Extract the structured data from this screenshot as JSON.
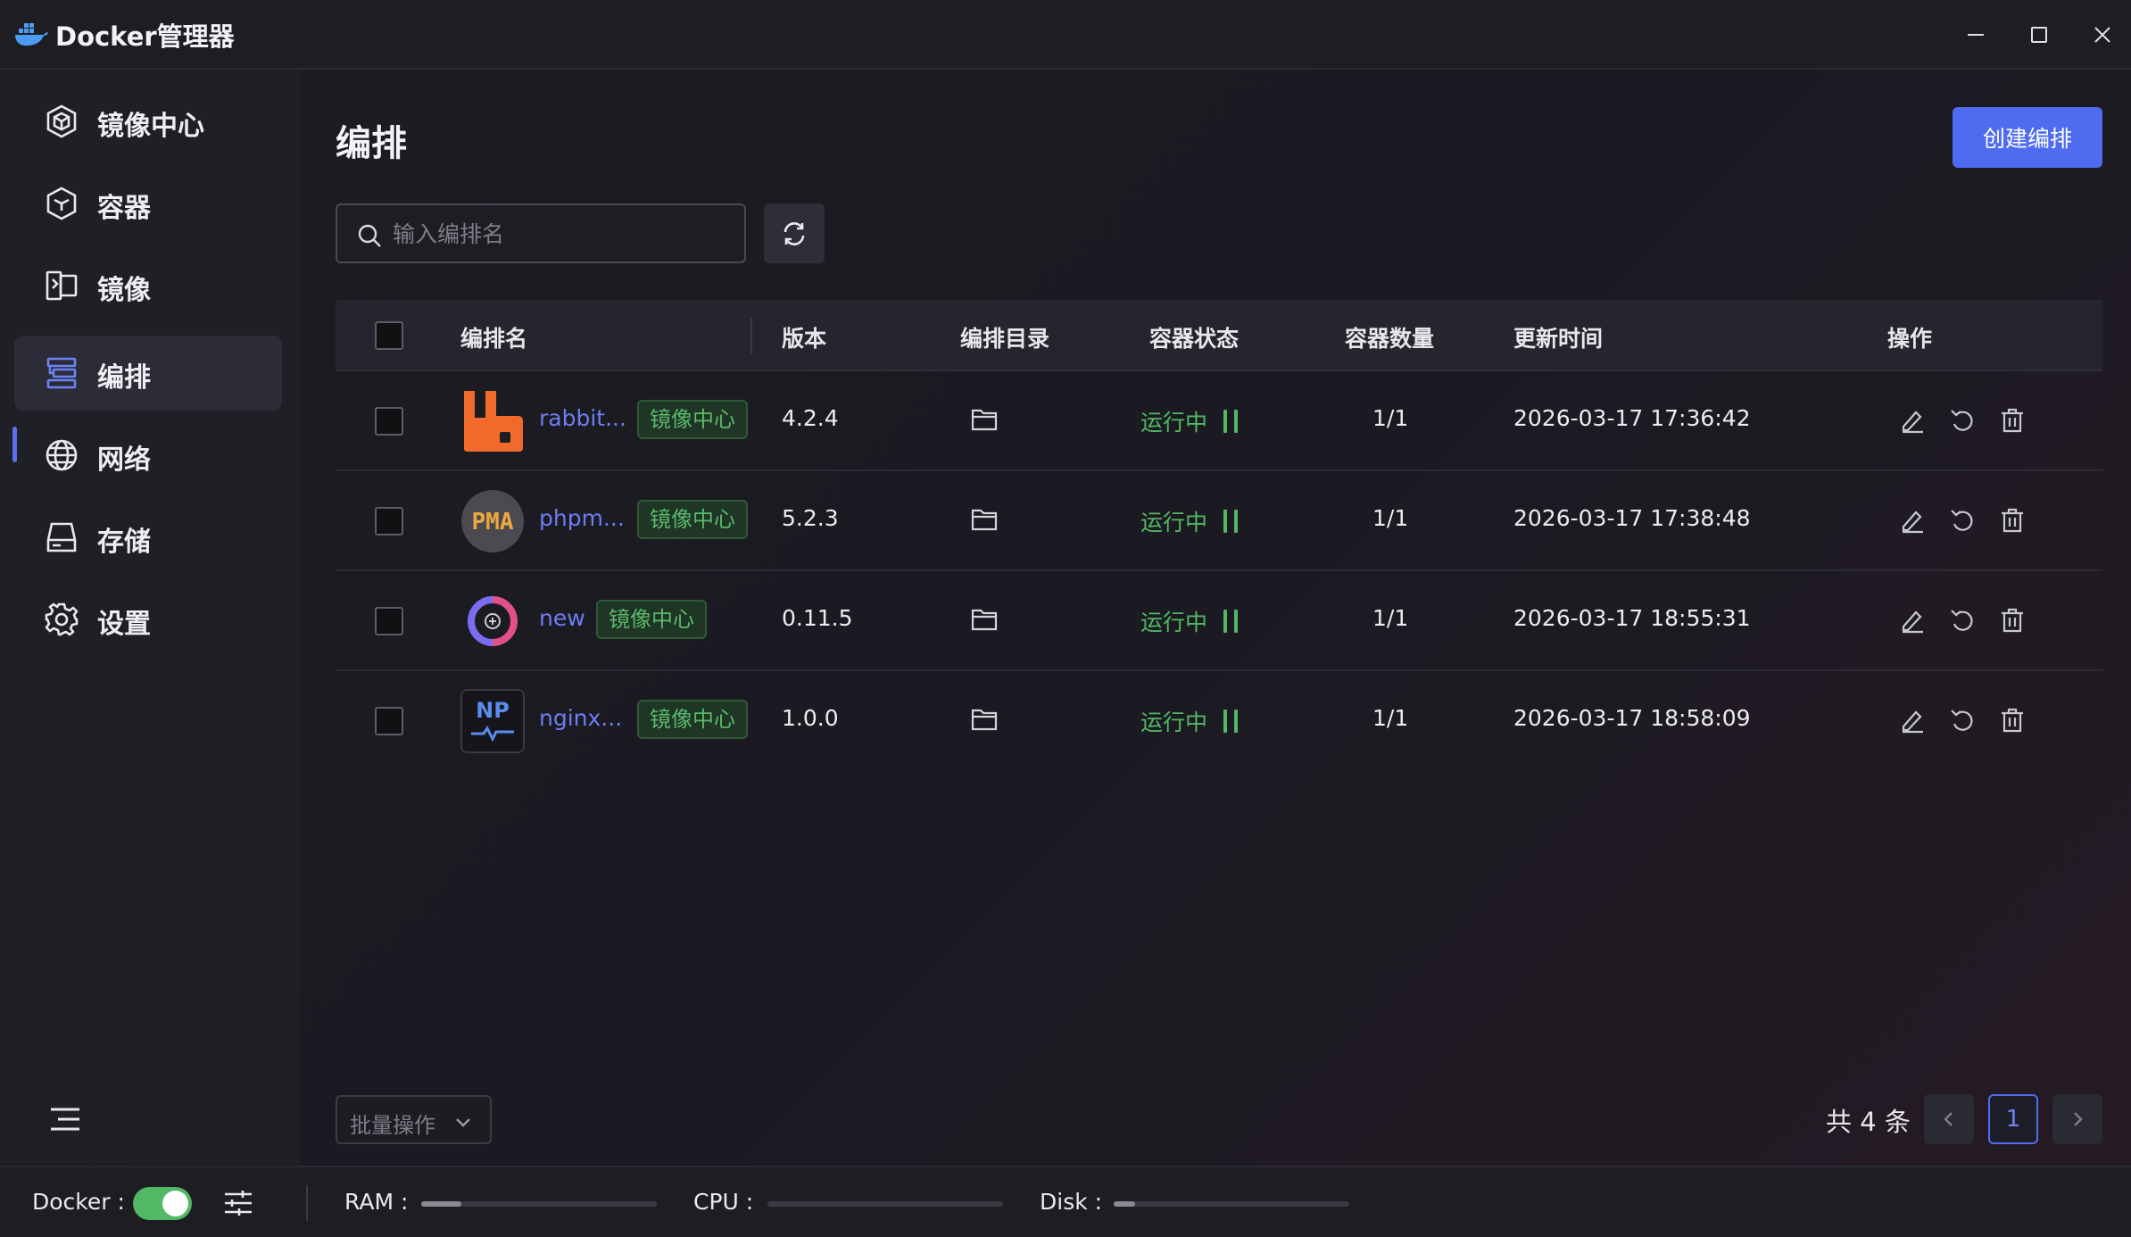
{
  "app": {
    "title": "Docker管理器"
  },
  "sidebar": {
    "items": [
      {
        "label": "镜像中心",
        "icon": "hub-icon"
      },
      {
        "label": "容器",
        "icon": "container-icon"
      },
      {
        "label": "镜像",
        "icon": "image-icon"
      },
      {
        "label": "编排",
        "icon": "compose-icon",
        "active": true
      },
      {
        "label": "网络",
        "icon": "network-icon"
      },
      {
        "label": "存储",
        "icon": "storage-icon"
      },
      {
        "label": "设置",
        "icon": "settings-icon"
      }
    ]
  },
  "page": {
    "title": "编排",
    "create_label": "创建编排"
  },
  "search": {
    "placeholder": "输入编排名"
  },
  "table": {
    "columns": [
      "编排名",
      "版本",
      "编排目录",
      "容器状态",
      "容器数量",
      "更新时间",
      "操作"
    ],
    "rows": [
      {
        "name": "rabbit...",
        "tag": "镜像中心",
        "version": "4.2.4",
        "status": "运行中",
        "count": "1/1",
        "updated": "2026-03-17 17:36:42",
        "icon": "rabbitmq-icon"
      },
      {
        "name": "phpm...",
        "tag": "镜像中心",
        "version": "5.2.3",
        "status": "运行中",
        "count": "1/1",
        "updated": "2026-03-17 17:38:48",
        "icon": "phpmyadmin-icon",
        "icon_text": "PMA"
      },
      {
        "name": "new",
        "tag": "镜像中心",
        "version": "0.11.5",
        "status": "运行中",
        "count": "1/1",
        "updated": "2026-03-17 18:55:31",
        "icon": "new-app-icon"
      },
      {
        "name": "nginx...",
        "tag": "镜像中心",
        "version": "1.0.0",
        "status": "运行中",
        "count": "1/1",
        "updated": "2026-03-17 18:58:09",
        "icon": "nginx-proxy-icon",
        "icon_text": "NP"
      }
    ]
  },
  "footer": {
    "batch_label": "批量操作",
    "total": "共 4 条",
    "current_page": "1"
  },
  "statusbar": {
    "docker_label": "Docker :",
    "ram_label": "RAM :",
    "cpu_label": "CPU :",
    "disk_label": "Disk :",
    "ram_usage": 0.17,
    "cpu_usage": 0.0,
    "disk_usage": 0.09
  },
  "colors": {
    "accent": "#4f6cf0",
    "running": "#52b864",
    "link": "#6d7df2"
  }
}
